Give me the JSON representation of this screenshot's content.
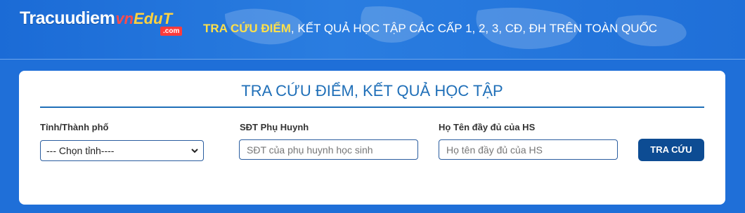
{
  "header": {
    "logo_main": "Tracuudiem",
    "logo_brand_vn": "vn",
    "logo_brand_edu": "EduT",
    "logo_domain": ".com",
    "tagline_highlight": "TRA CỨU ĐIỂM",
    "tagline_rest": ", KẾT QUẢ HỌC TẬP CÁC CẤP 1, 2, 3, CĐ, ĐH TRÊN TOÀN QUỐC"
  },
  "form": {
    "title": "TRA CỨU ĐIỂM, KẾT QUẢ HỌC TẬP",
    "province": {
      "label": "Tỉnh/Thành phố",
      "selected": "--- Chọn tỉnh----"
    },
    "phone": {
      "label": "SĐT Phụ Huynh",
      "value": "",
      "placeholder": "SĐT của phụ huynh học sinh"
    },
    "fullname": {
      "label": "Họ Tên đầy đủ của HS",
      "value": "",
      "placeholder": "Họ tên đầy đủ của HS"
    },
    "submit_label": "TRA CỨU"
  },
  "colors": {
    "header_bg": "#1f6fd8",
    "highlight": "#ffe04a",
    "title_blue": "#1f6fb8",
    "button_bg": "#0d4c93"
  }
}
